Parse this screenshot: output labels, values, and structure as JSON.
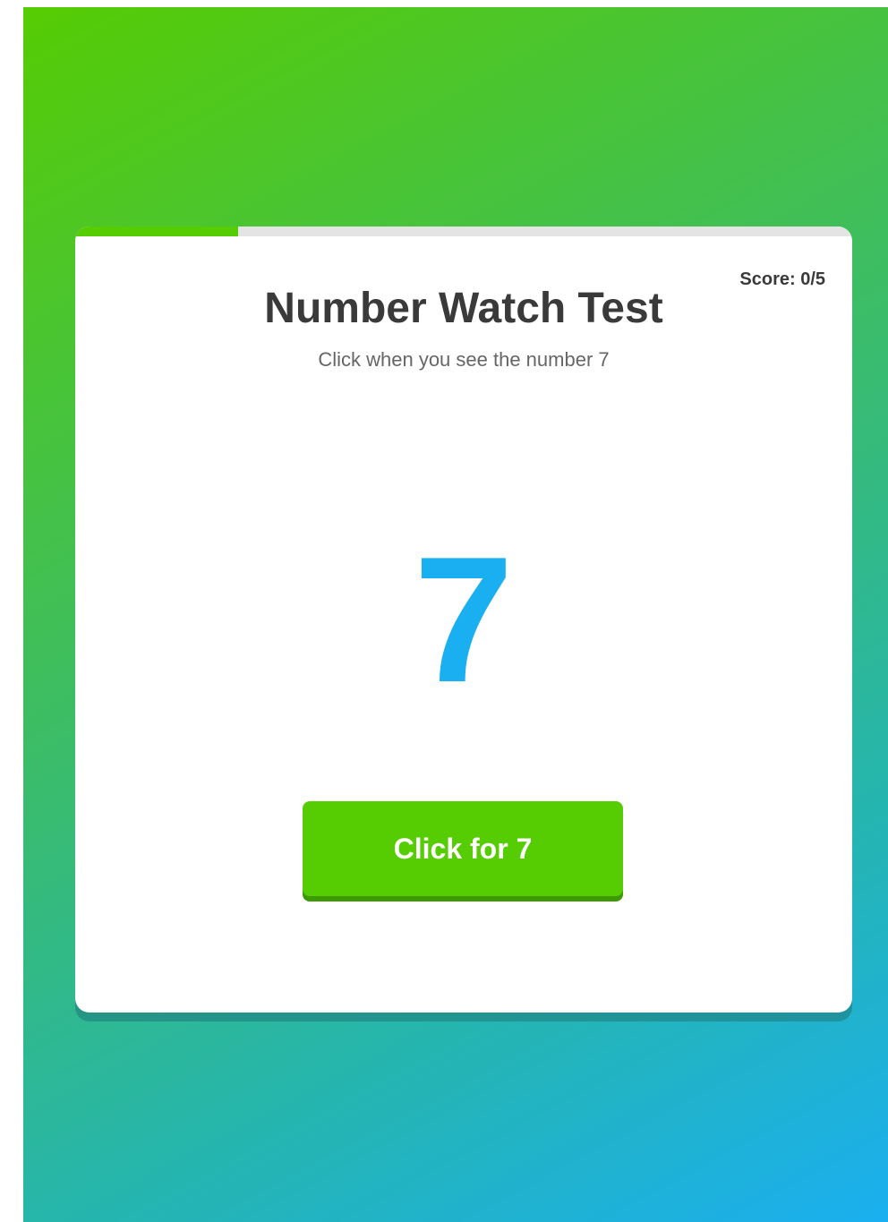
{
  "game": {
    "title": "Number Watch Test",
    "instruction": "Click when you see the number 7",
    "score_label": "Score: 0/5",
    "current_number": "7",
    "button_label": "Click for 7",
    "progress_fraction": 0.21
  },
  "colors": {
    "accent_green": "#56cc03",
    "number_blue": "#1aaff0",
    "title_text": "#3a3a3a",
    "gradient_start": "#56cc03",
    "gradient_end": "#1aaff0"
  }
}
